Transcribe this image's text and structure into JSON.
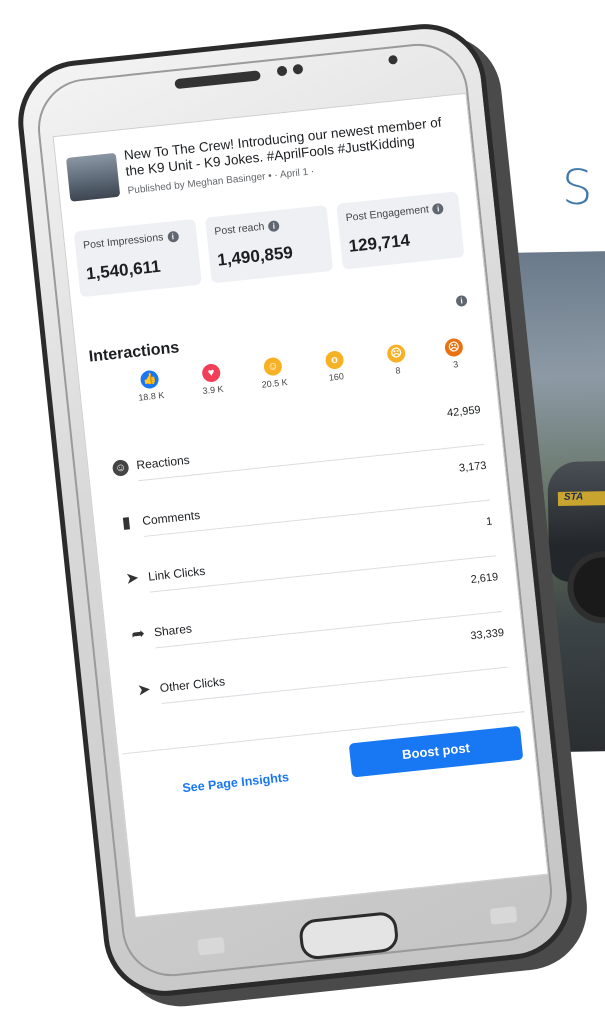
{
  "background": {
    "letter": "S",
    "car_stripe_text": "STA"
  },
  "post": {
    "title": "New To The Crew! Introducing our newest member of the K9 Unit - K9 Jokes. #AprilFools #JustKidding",
    "meta": "Published by Meghan Basinger • · April 1 ·"
  },
  "stats": [
    {
      "label": "Post Impressions",
      "value": "1,540,611"
    },
    {
      "label": "Post reach",
      "value": "1,490,859"
    },
    {
      "label": "Post Engagement",
      "value": "129,714"
    }
  ],
  "interactions": {
    "title": "Interactions",
    "reactions": [
      {
        "icon": "like-icon",
        "color": "#1877f2",
        "count": "18.8 K"
      },
      {
        "icon": "love-icon",
        "color": "#f33e58",
        "count": "3.9 K"
      },
      {
        "icon": "haha-icon",
        "color": "#f7b125",
        "count": "20.5 K"
      },
      {
        "icon": "wow-icon",
        "color": "#f7b125",
        "count": "160"
      },
      {
        "icon": "sad-icon",
        "color": "#f7b125",
        "count": "8"
      },
      {
        "icon": "angry-icon",
        "color": "#e9710f",
        "count": "3"
      }
    ],
    "metrics": [
      {
        "icon": "smiley-icon",
        "label": "Reactions",
        "value": "42,959"
      },
      {
        "icon": "comment-icon",
        "label": "Comments",
        "value": "3,173"
      },
      {
        "icon": "cursor-icon",
        "label": "Link Clicks",
        "value": "1"
      },
      {
        "icon": "share-icon",
        "label": "Shares",
        "value": "2,619"
      },
      {
        "icon": "cursor-icon",
        "label": "Other Clicks",
        "value": "33,339"
      }
    ]
  },
  "footer": {
    "insights_label": "See Page Insights",
    "boost_label": "Boost post"
  }
}
